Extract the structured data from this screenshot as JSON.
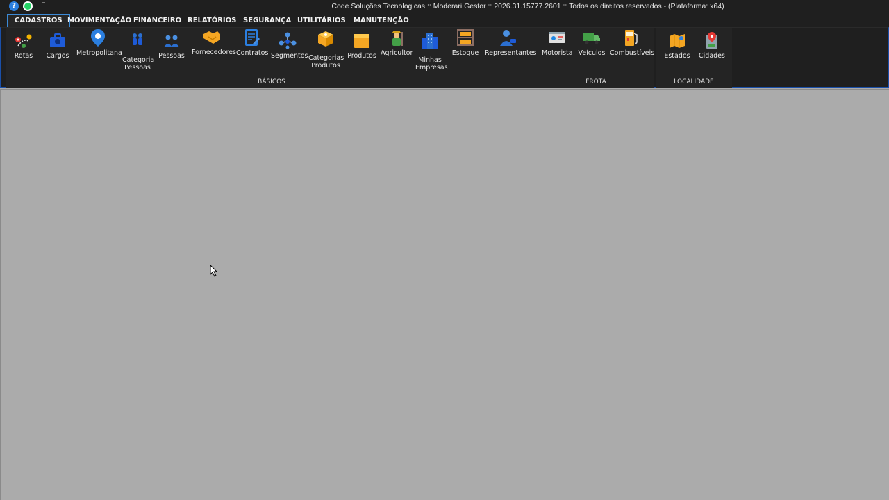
{
  "title": "Code Soluções Tecnologicas :: Moderari Gestor :: 2026.31.15777.2601 :: Todos os direitos reservados - (Plataforma: x64)",
  "quick_access": {
    "help": "?",
    "more": "⁼"
  },
  "tabs": [
    {
      "label": "CADASTROS",
      "active": true
    },
    {
      "label": "MOVIMENTAÇÃO"
    },
    {
      "label": "FINANCEIRO"
    },
    {
      "label": "RELATÓRIOS"
    },
    {
      "label": "SEGURANÇA"
    },
    {
      "label": "UTILITÁRIOS"
    },
    {
      "label": "MANUTENÇÃO"
    }
  ],
  "groups": {
    "basicos": {
      "label": "BÁSICOS"
    },
    "frota": {
      "label": "FROTA"
    },
    "localidade": {
      "label": "LOCALIDADE"
    }
  },
  "buttons": {
    "rotas": {
      "line1": "Rotas",
      "line2": ""
    },
    "cargos": {
      "line1": "Cargos",
      "line2": ""
    },
    "metropolitana": {
      "line1": "Metropolitana",
      "line2": ""
    },
    "categoria_pessoas": {
      "line1": "Categoria",
      "line2": "Pessoas"
    },
    "pessoas": {
      "line1": "Pessoas",
      "line2": ""
    },
    "fornecedores": {
      "line1": "Fornecedores",
      "line2": ""
    },
    "contratos": {
      "line1": "Contratos",
      "line2": ""
    },
    "segmentos": {
      "line1": "Segmentos",
      "line2": ""
    },
    "categorias_produtos": {
      "line1": "Categorias",
      "line2": "Produtos"
    },
    "produtos": {
      "line1": "Produtos",
      "line2": ""
    },
    "agricultor": {
      "line1": "Agricultor",
      "line2": ""
    },
    "minhas_empresas": {
      "line1": "Minhas",
      "line2": "Empresas"
    },
    "estoque": {
      "line1": "Estoque",
      "line2": ""
    },
    "representantes": {
      "line1": "Representantes",
      "line2": ""
    },
    "motorista": {
      "line1": "Motorista",
      "line2": ""
    },
    "veiculos": {
      "line1": "Veículos",
      "line2": ""
    },
    "combustiveis": {
      "line1": "Combustíveis",
      "line2": ""
    },
    "estados": {
      "line1": "Estados",
      "line2": ""
    },
    "cidades": {
      "line1": "Cidades",
      "line2": ""
    }
  },
  "colors": {
    "accent": "#3c8ad6",
    "ribbon_border": "#1a4fa8",
    "workspace": "#ababab",
    "chrome": "#1f1f1f"
  }
}
